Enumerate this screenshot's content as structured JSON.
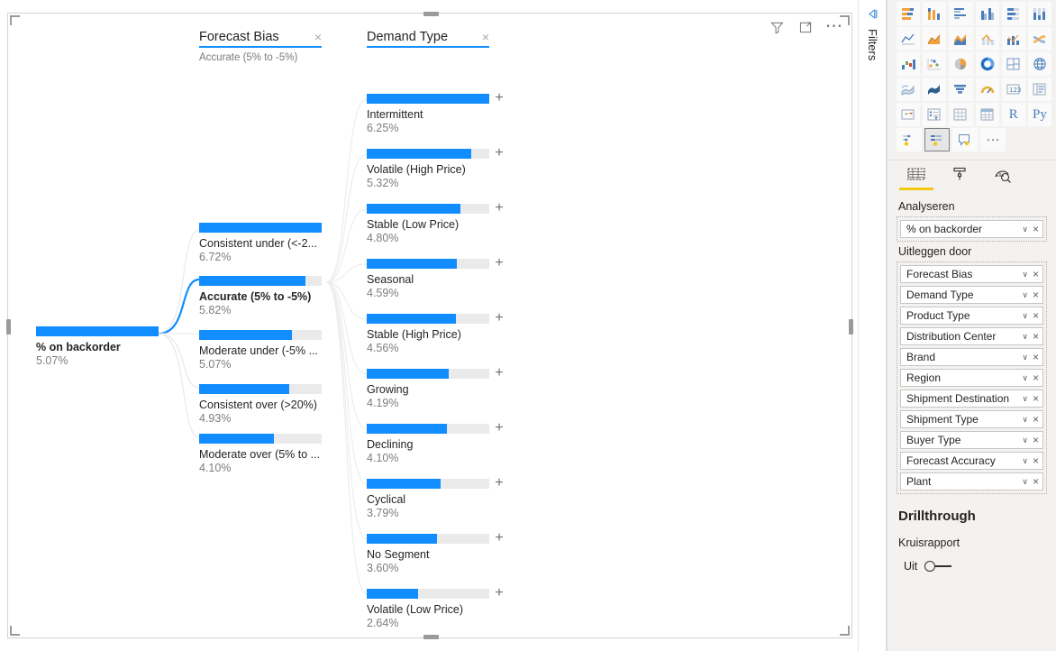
{
  "visual_toolbar": {
    "filter_icon": "filter-icon",
    "focus_icon": "focus-mode-icon",
    "more_options": "⋯"
  },
  "tree": {
    "levels": [
      {
        "title": "Forecast Bias",
        "subtitle": "Accurate (5% to -5%)",
        "close": "×"
      },
      {
        "title": "Demand Type",
        "subtitle": "",
        "close": "×"
      }
    ],
    "root": {
      "label": "% on backorder",
      "value": "5.07%",
      "pct": 100
    },
    "forecast_bias": [
      {
        "label": "Consistent under (<-2...",
        "value": "6.72%",
        "pct": 100,
        "selected": false
      },
      {
        "label": "Accurate (5% to -5%)",
        "value": "5.82%",
        "pct": 86.6,
        "selected": true
      },
      {
        "label": "Moderate under (-5% ...",
        "value": "5.07%",
        "pct": 75.4,
        "selected": false
      },
      {
        "label": "Consistent over (>20%)",
        "value": "4.93%",
        "pct": 73.4,
        "selected": false
      },
      {
        "label": "Moderate over (5% to ...",
        "value": "4.10%",
        "pct": 61.0,
        "selected": false
      }
    ],
    "demand_type": [
      {
        "label": "Intermittent",
        "value": "6.25%",
        "pct": 100,
        "expand": "+"
      },
      {
        "label": "Volatile (High Price)",
        "value": "5.32%",
        "pct": 85.1,
        "expand": "+"
      },
      {
        "label": "Stable (Low Price)",
        "value": "4.80%",
        "pct": 76.8,
        "expand": "+"
      },
      {
        "label": "Seasonal",
        "value": "4.59%",
        "pct": 73.4,
        "expand": "+"
      },
      {
        "label": "Stable (High Price)",
        "value": "4.56%",
        "pct": 73.0,
        "expand": "+"
      },
      {
        "label": "Growing",
        "value": "4.19%",
        "pct": 67.0,
        "expand": "+"
      },
      {
        "label": "Declining",
        "value": "4.10%",
        "pct": 65.6,
        "expand": "+"
      },
      {
        "label": "Cyclical",
        "value": "3.79%",
        "pct": 60.6,
        "expand": "+"
      },
      {
        "label": "No Segment",
        "value": "3.60%",
        "pct": 57.6,
        "expand": "+"
      },
      {
        "label": "Volatile (Low Price)",
        "value": "2.64%",
        "pct": 42.2,
        "expand": "+"
      }
    ]
  },
  "chart_data": {
    "type": "bar",
    "title": "% on backorder decomposition tree",
    "root": {
      "label": "% on backorder",
      "value": 5.07,
      "unit": "%"
    },
    "levels": [
      {
        "name": "Forecast Bias",
        "selected_category": "Accurate (5% to -5%)",
        "categories": [
          "Consistent under (<-2...",
          "Accurate (5% to -5%)",
          "Moderate under (-5% ...",
          "Consistent over (>20%)",
          "Moderate over (5% to ..."
        ],
        "values": [
          6.72,
          5.82,
          5.07,
          4.93,
          4.1
        ],
        "ylabel": "% on backorder",
        "max": 6.72
      },
      {
        "name": "Demand Type",
        "parent": "Accurate (5% to -5%)",
        "categories": [
          "Intermittent",
          "Volatile (High Price)",
          "Stable (Low Price)",
          "Seasonal",
          "Stable (High Price)",
          "Growing",
          "Declining",
          "Cyclical",
          "No Segment",
          "Volatile (Low Price)"
        ],
        "values": [
          6.25,
          5.32,
          4.8,
          4.59,
          4.56,
          4.19,
          4.1,
          3.79,
          3.6,
          2.64
        ],
        "ylabel": "% on backorder",
        "max": 6.25
      }
    ]
  },
  "filters_rail": {
    "label": "Filters",
    "expand_icon": "expand-panel-icon"
  },
  "right_pane": {
    "gallery": {
      "rows": [
        [
          {
            "name": "stacked-bar-chart-icon"
          },
          {
            "name": "stacked-column-chart-icon"
          },
          {
            "name": "clustered-bar-chart-icon"
          },
          {
            "name": "clustered-column-chart-icon"
          },
          {
            "name": "100-stacked-bar-chart-icon"
          },
          {
            "name": "100-stacked-column-chart-icon"
          }
        ],
        [
          {
            "name": "line-chart-icon"
          },
          {
            "name": "area-chart-icon"
          },
          {
            "name": "stacked-area-chart-icon"
          },
          {
            "name": "line-stacked-column-chart-icon"
          },
          {
            "name": "line-clustered-column-chart-icon"
          },
          {
            "name": "ribbon-chart-icon"
          }
        ],
        [
          {
            "name": "waterfall-chart-icon"
          },
          {
            "name": "scatter-chart-icon"
          },
          {
            "name": "pie-chart-icon"
          },
          {
            "name": "donut-chart-icon"
          },
          {
            "name": "treemap-icon"
          },
          {
            "name": "map-icon"
          }
        ],
        [
          {
            "name": "filled-map-icon"
          },
          {
            "name": "shape-map-icon"
          },
          {
            "name": "funnel-chart-icon"
          },
          {
            "name": "gauge-icon"
          },
          {
            "name": "card-icon"
          },
          {
            "name": "multi-row-card-icon"
          }
        ],
        [
          {
            "name": "kpi-icon"
          },
          {
            "name": "slicer-icon"
          },
          {
            "name": "table-icon"
          },
          {
            "name": "matrix-icon"
          },
          {
            "name": "r-script-visual-icon",
            "text": "R"
          },
          {
            "name": "python-visual-icon",
            "text": "Py"
          }
        ],
        [
          {
            "name": "key-influencers-icon"
          },
          {
            "name": "decomposition-tree-icon",
            "selected": true
          },
          {
            "name": "qa-visual-icon"
          },
          {
            "name": "more-visuals-icon",
            "dots": "···"
          }
        ]
      ]
    },
    "format_tabs": [
      {
        "name": "fields-tab-icon",
        "active": true
      },
      {
        "name": "format-tab-icon",
        "active": false
      },
      {
        "name": "analytics-tab-icon",
        "active": false
      }
    ],
    "analyze_label": "Analyseren",
    "analyze_field": {
      "name": "% on backorder",
      "chevron": "∨",
      "remove": "×"
    },
    "explain_by_label": "Uitleggen door",
    "explain_by_fields": [
      {
        "name": "Forecast Bias",
        "chevron": "∨",
        "remove": "×"
      },
      {
        "name": "Demand Type",
        "chevron": "∨",
        "remove": "×"
      },
      {
        "name": "Product Type",
        "chevron": "∨",
        "remove": "×"
      },
      {
        "name": "Distribution Center",
        "chevron": "∨",
        "remove": "×"
      },
      {
        "name": "Brand",
        "chevron": "∨",
        "remove": "×"
      },
      {
        "name": "Region",
        "chevron": "∨",
        "remove": "×"
      },
      {
        "name": "Shipment Destination",
        "chevron": "∨",
        "remove": "×"
      },
      {
        "name": "Shipment Type",
        "chevron": "∨",
        "remove": "×"
      },
      {
        "name": "Buyer Type",
        "chevron": "∨",
        "remove": "×"
      },
      {
        "name": "Forecast Accuracy",
        "chevron": "∨",
        "remove": "×"
      },
      {
        "name": "Plant",
        "chevron": "∨",
        "remove": "×"
      }
    ],
    "drillthrough_title": "Drillthrough",
    "cross_report_label": "Kruisrapport",
    "cross_report_toggle": {
      "state_label": "Uit",
      "on": false
    }
  },
  "colors": {
    "accent_blue": "#118dff",
    "bar_track": "#eaeaea",
    "pane_bg": "#f3f2f1",
    "tab_underline": "#f2c811",
    "link_gray": "#e6e6e6"
  }
}
